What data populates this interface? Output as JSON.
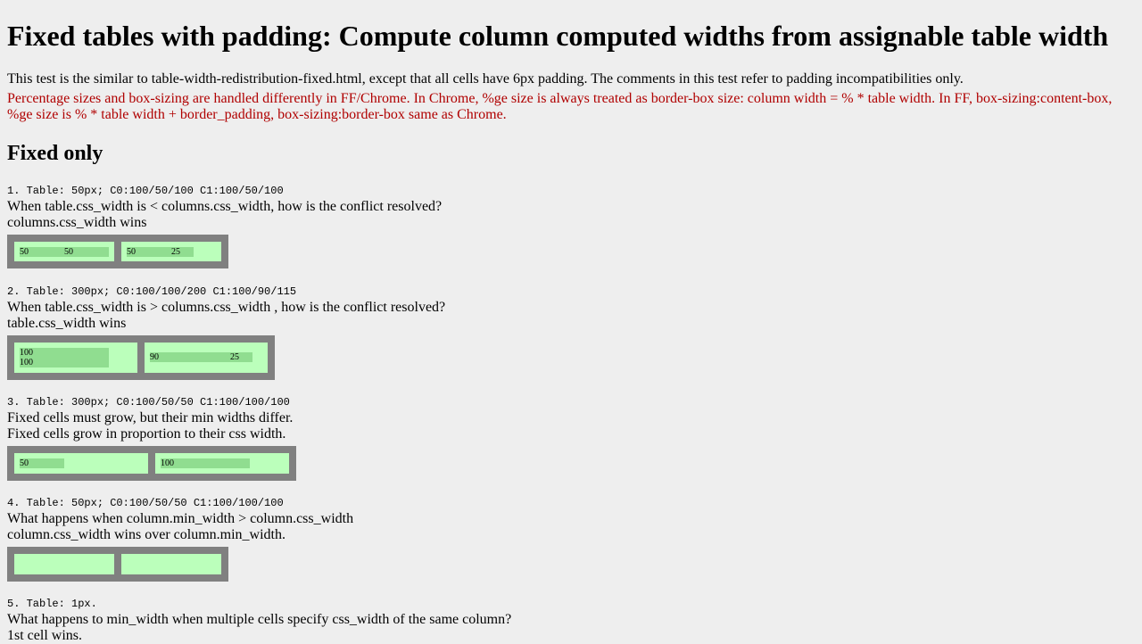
{
  "title": "Fixed tables with padding: Compute column computed widths from assignable table width",
  "intro": "This test is the similar to table-width-redistribution-fixed.html, except that all cells have 6px padding. The comments in this test refer to padding incompatibilities only.",
  "note_line1": "Percentage sizes and box-sizing are handled differently in FF/Chrome. In Chrome, %ge size is always treated as border-box size: column width = % * table width. In FF, box-sizing:content-box,",
  "note_line2": "%ge size is % * table width + border_padding, box-sizing:border-box same as Chrome.",
  "section_title": "Fixed only",
  "tests": [
    {
      "spec": "1. Table: 50px; C0:100/50/100 C1:100/50/100",
      "question": "When table.css_width is < columns.css_width, how is the conflict resolved?",
      "answer": "columns.css_width wins",
      "cells": [
        {
          "a": "50",
          "b": "50"
        },
        {
          "a": "50",
          "b": "25"
        }
      ]
    },
    {
      "spec": "2. Table: 300px; C0:100/100/200 C1:100/90/115",
      "question": "When table.css_width is > columns.css_width , how is the conflict resolved?",
      "answer": "table.css_width wins",
      "cells": [
        {
          "a": "100",
          "b": "100"
        },
        {
          "a": "90",
          "b": "25"
        }
      ]
    },
    {
      "spec": "3. Table: 300px; C0:100/50/50 C1:100/100/100",
      "question": "Fixed cells must grow, but their min widths differ.",
      "answer": "Fixed cells grow in proportion to their css width.",
      "cells": [
        {
          "a": "50"
        },
        {
          "a": "100"
        }
      ]
    },
    {
      "spec": "4. Table: 50px; C0:100/50/50 C1:100/100/100",
      "question": "What happens when column.min_width > column.css_width",
      "answer": "column.css_width wins over column.min_width."
    },
    {
      "spec": "5. Table: 1px.",
      "question": "What happens to min_width when multiple cells specify css_width of the same column?",
      "answer": "1st cell wins."
    }
  ]
}
